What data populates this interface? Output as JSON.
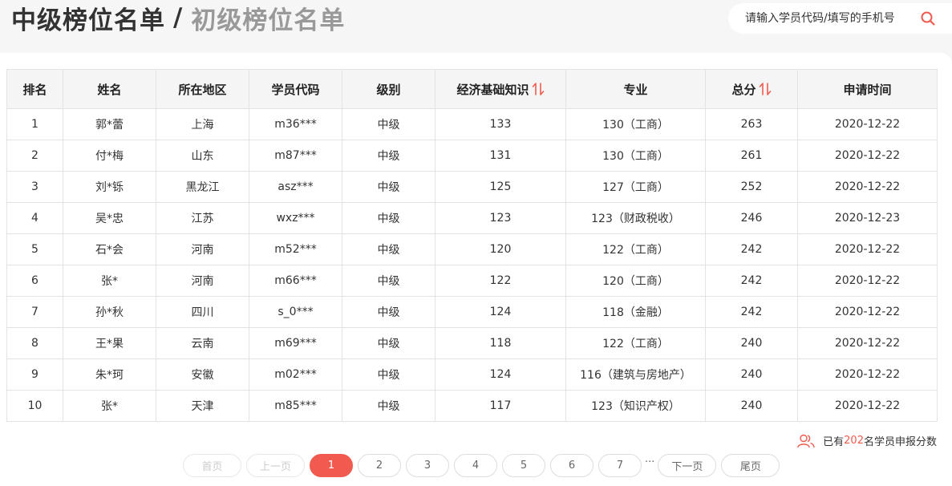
{
  "header": {
    "active_tab": "中级榜位名单",
    "separator": "/",
    "inactive_tab": "初级榜位名单"
  },
  "search": {
    "placeholder": "请输入学员代码/填写的手机号",
    "icon": "search-icon",
    "accent_color": "#f15b4f"
  },
  "table": {
    "columns": [
      "排名",
      "姓名",
      "所在地区",
      "学员代码",
      "级别",
      "经济基础知识",
      "专业",
      "总分",
      "申请时间"
    ],
    "sortable_columns": [
      "经济基础知识",
      "总分"
    ],
    "rows": [
      [
        "1",
        "郭*蕾",
        "上海",
        "m36***",
        "中级",
        "133",
        "130（工商）",
        "263",
        "2020-12-22"
      ],
      [
        "2",
        "付*梅",
        "山东",
        "m87***",
        "中级",
        "131",
        "130（工商）",
        "261",
        "2020-12-22"
      ],
      [
        "3",
        "刘*铄",
        "黑龙江",
        "asz***",
        "中级",
        "125",
        "127（工商）",
        "252",
        "2020-12-22"
      ],
      [
        "4",
        "吴*忠",
        "江苏",
        "wxz***",
        "中级",
        "123",
        "123（财政税收）",
        "246",
        "2020-12-23"
      ],
      [
        "5",
        "石*会",
        "河南",
        "m52***",
        "中级",
        "120",
        "122（工商）",
        "242",
        "2020-12-22"
      ],
      [
        "6",
        "张*",
        "河南",
        "m66***",
        "中级",
        "122",
        "120（工商）",
        "242",
        "2020-12-22"
      ],
      [
        "7",
        "孙*秋",
        "四川",
        "s_0***",
        "中级",
        "124",
        "118（金融）",
        "242",
        "2020-12-22"
      ],
      [
        "8",
        "王*果",
        "云南",
        "m69***",
        "中级",
        "118",
        "122（工商）",
        "240",
        "2020-12-22"
      ],
      [
        "9",
        "朱*珂",
        "安徽",
        "m02***",
        "中级",
        "124",
        "116（建筑与房地产）",
        "240",
        "2020-12-22"
      ],
      [
        "10",
        "张*",
        "天津",
        "m85***",
        "中级",
        "117",
        "123（知识产权）",
        "240",
        "2020-12-22"
      ]
    ]
  },
  "stats": {
    "prefix": "已有",
    "count": "202",
    "suffix": "名学员申报分数"
  },
  "pagination": {
    "first": "首页",
    "prev": "上一页",
    "pages": [
      "1",
      "2",
      "3",
      "4",
      "5",
      "6",
      "7"
    ],
    "current": "1",
    "ellipsis": "···",
    "next": "下一页",
    "last": "尾页"
  }
}
